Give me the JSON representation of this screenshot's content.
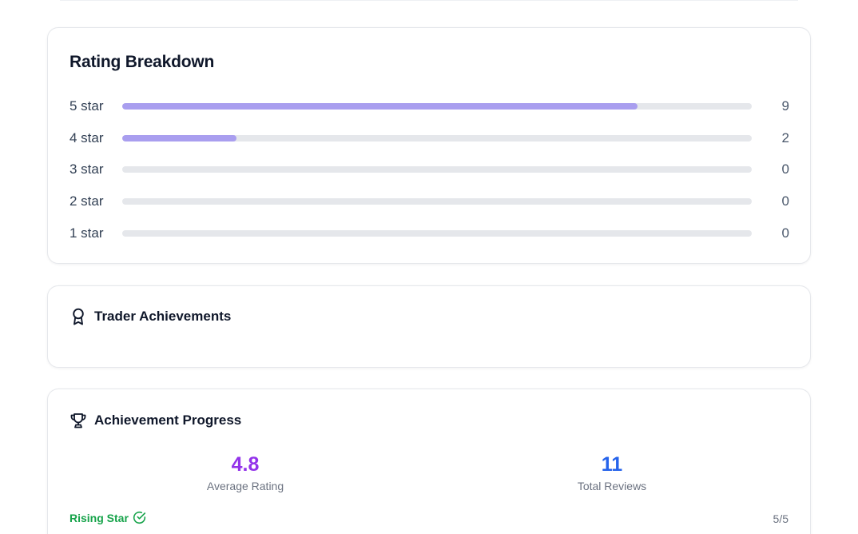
{
  "rating_breakdown": {
    "title": "Rating Breakdown",
    "bar_color": "#a99eef",
    "track_color": "#e5e7eb",
    "rows": [
      {
        "label": "5 star",
        "count": "9",
        "fraction": 0.818
      },
      {
        "label": "4 star",
        "count": "2",
        "fraction": 0.182
      },
      {
        "label": "3 star",
        "count": "0",
        "fraction": 0
      },
      {
        "label": "2 star",
        "count": "0",
        "fraction": 0
      },
      {
        "label": "1 star",
        "count": "0",
        "fraction": 0
      }
    ]
  },
  "trader_achievements": {
    "title": "Trader Achievements",
    "icon": "award-ribbon-icon"
  },
  "achievement_progress": {
    "title": "Achievement Progress",
    "icon": "trophy-icon",
    "average_rating": {
      "value": "4.8",
      "caption": "Average Rating",
      "color": "#9333ea"
    },
    "total_reviews": {
      "value": "11",
      "caption": "Total Reviews",
      "color": "#2563eb"
    },
    "milestone": {
      "name": "Rising Star",
      "icon": "check-circle-icon",
      "progress": "5/5",
      "color": "#16a34a"
    }
  }
}
